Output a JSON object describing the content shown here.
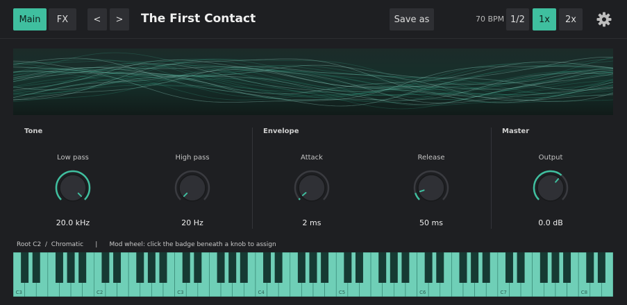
{
  "topbar": {
    "tabs": [
      {
        "label": "Main",
        "active": true
      },
      {
        "label": "FX",
        "active": false
      }
    ],
    "prev_label": "<",
    "next_label": ">",
    "preset_title": "The First Contact",
    "save_as_label": "Save as",
    "bpm_label": "70 BPM",
    "speed_options": [
      {
        "label": "1/2",
        "active": false
      },
      {
        "label": "1x",
        "active": true
      },
      {
        "label": "2x",
        "active": false
      }
    ],
    "settings_icon": "gear-icon"
  },
  "sections": {
    "tone": {
      "label": "Tone",
      "knobs": [
        {
          "label": "Low pass",
          "value": "20.0 kHz",
          "level": 1.0
        },
        {
          "label": "High pass",
          "value": "20 Hz",
          "level": 0.0
        }
      ]
    },
    "envelope": {
      "label": "Envelope",
      "knobs": [
        {
          "label": "Attack",
          "value": "2 ms",
          "level": 0.02
        },
        {
          "label": "Release",
          "value": "50 ms",
          "level": 0.1
        }
      ]
    },
    "master": {
      "label": "Master",
      "knobs": [
        {
          "label": "Output",
          "value": "0.0 dB",
          "level": 0.65
        }
      ]
    }
  },
  "info": {
    "root": "Root C2",
    "separator": "/",
    "scale": "Chromatic",
    "pipe": "|",
    "mod_wheel_hint": "Mod wheel: click the badge beneath a knob to assign"
  },
  "keyboard": {
    "octave_labels": [
      "C3",
      "C2",
      "C3",
      "C4",
      "C5",
      "C6",
      "C7",
      "C8"
    ]
  },
  "colors": {
    "accent": "#3fbf9f",
    "background": "#1e1f22",
    "key_color": "#6fcfb7",
    "black_key": "#163a33"
  }
}
